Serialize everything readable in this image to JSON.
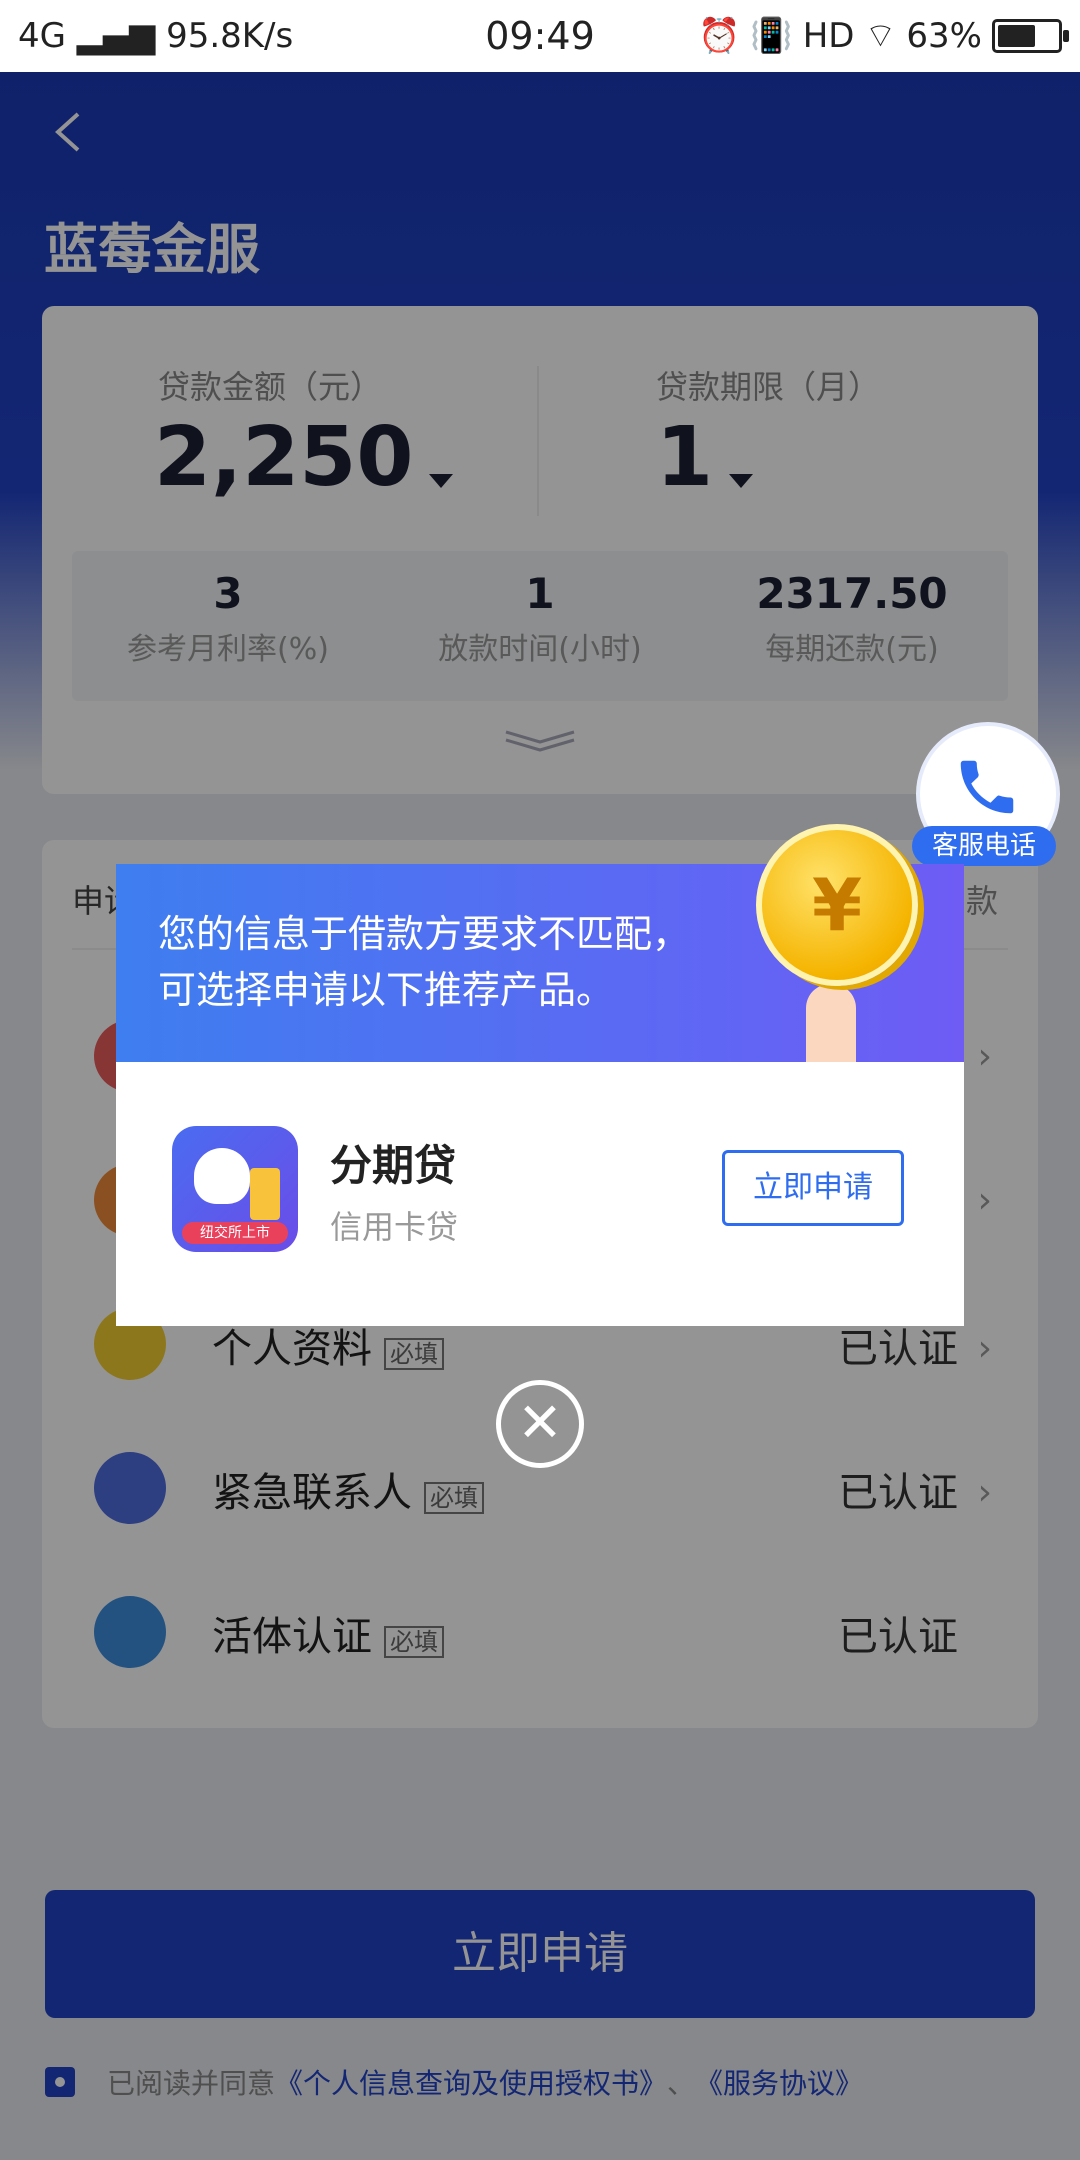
{
  "status_bar": {
    "network": "4G",
    "speed": "95.8K/s",
    "time": "09:49",
    "hd": "HD",
    "battery": "63%"
  },
  "header": {
    "title": "蓝莓金服"
  },
  "loan": {
    "amount_label": "贷款金额（元）",
    "amount_value": "2,250",
    "term_label": "贷款期限（月）",
    "term_value": "1",
    "stats": [
      {
        "value": "3",
        "label": "参考月利率(%)"
      },
      {
        "value": "1",
        "label": "放款时间(小时)"
      },
      {
        "value": "2317.50",
        "label": "每期还款(元)"
      }
    ]
  },
  "service": {
    "label": "客服电话"
  },
  "list": {
    "header_left": "申请",
    "header_right": "款",
    "items": [
      {
        "name": "个人资料",
        "tag": "必填",
        "status": "已认证",
        "color": "#f3cd32"
      },
      {
        "name": "紧急联系人",
        "tag": "必填",
        "status": "已认证",
        "color": "#4e6bdf"
      },
      {
        "name": "活体认证",
        "tag": "必填",
        "status": "已认证",
        "color": "#3d8ddc"
      }
    ]
  },
  "bottom": {
    "apply_label": "立即申请",
    "agree_text": "已阅读并同意",
    "link1": "《个人信息查询及使用授权书》",
    "sep": "、",
    "link2": "《服务协议》"
  },
  "modal": {
    "message_line1": "您的信息于借款方要求不匹配，",
    "message_line2": "可选择申请以下推荐产品。",
    "coin_symbol": "¥",
    "product_name": "分期贷",
    "product_sub": "信用卡贷",
    "product_badge": "纽交所上市",
    "apply_button": "立即申请",
    "close_symbol": "✕"
  }
}
